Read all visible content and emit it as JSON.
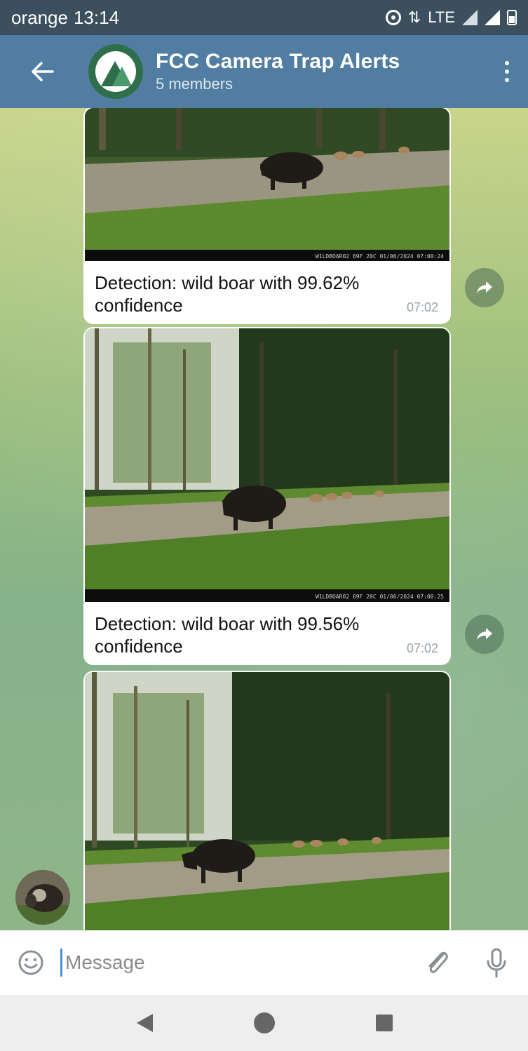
{
  "status_bar": {
    "carrier": "orange",
    "time": "13:14",
    "network": "LTE"
  },
  "header": {
    "title": "FCC Camera Trap Alerts",
    "subtitle": "5 members"
  },
  "messages": [
    {
      "caption": "Detection: wild boar with 99.62% confidence",
      "time": "07:02",
      "camera_stamp": "W1LDBOAR02   69F 20C  01/06/2024 07:00:24"
    },
    {
      "caption": "Detection: wild boar with 99.56% confidence",
      "time": "07:02",
      "camera_stamp": "W1LDBOAR02   69F 20C  01/06/2024 07:00:25"
    },
    {
      "caption": "",
      "time": "",
      "camera_stamp": ""
    }
  ],
  "input": {
    "placeholder": "Message"
  },
  "colors": {
    "header_bg": "#517da2",
    "status_bg": "#3b4f5f",
    "bubble_bg": "#ffffff",
    "accent": "#4a90d9"
  },
  "icons": {
    "back": "arrow-left-icon",
    "menu": "more-vertical-icon",
    "forward": "share-arrow-icon",
    "emoji": "smiley-icon",
    "attach": "paperclip-icon",
    "mic": "microphone-icon",
    "nav_back": "triangle-back-icon",
    "nav_home": "circle-home-icon",
    "nav_recent": "square-recent-icon"
  }
}
